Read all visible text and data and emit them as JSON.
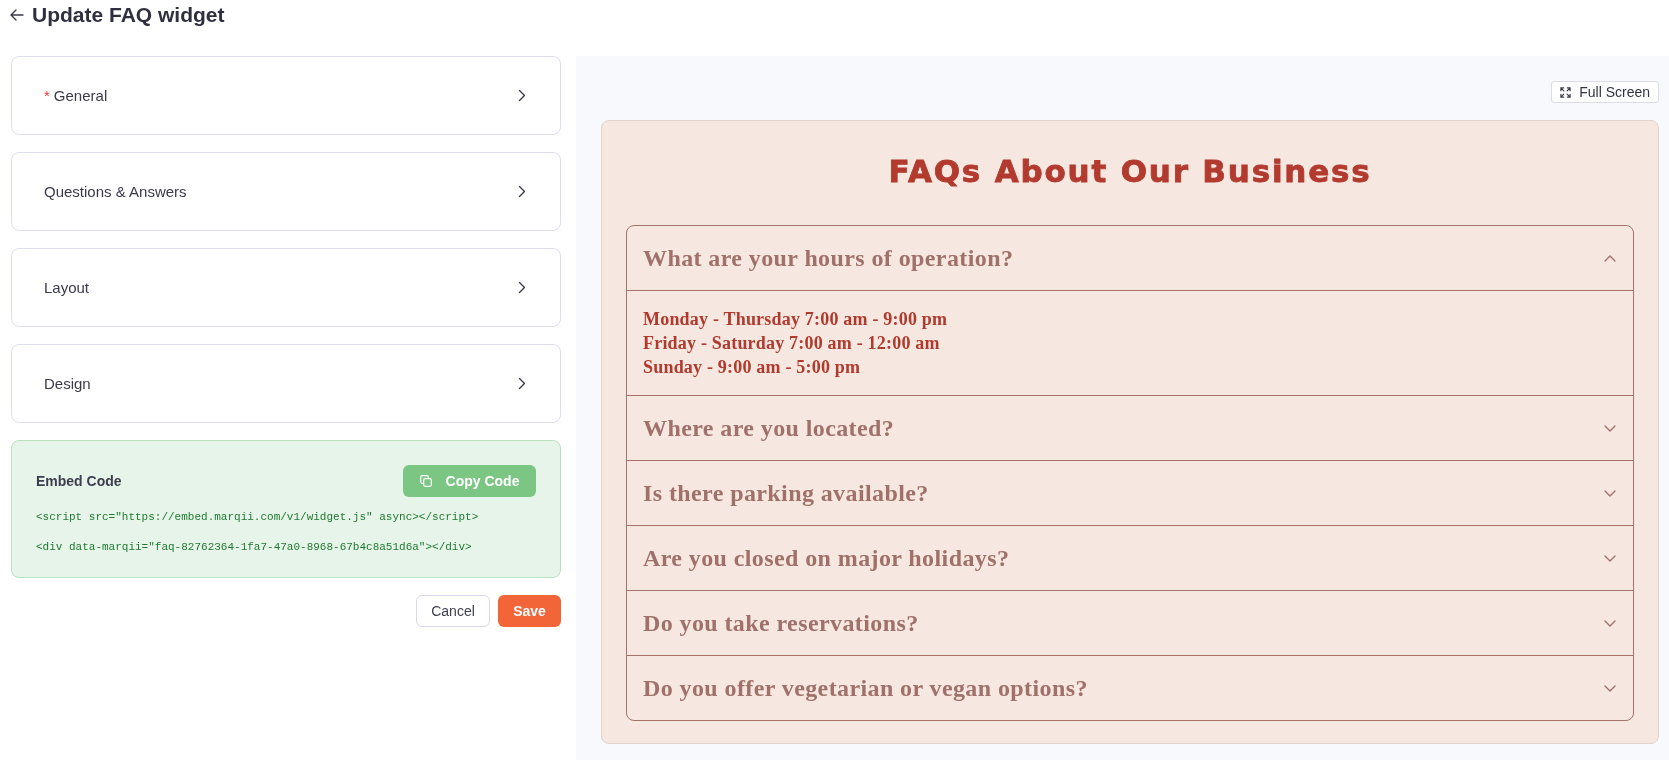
{
  "header": {
    "title": "Update FAQ widget"
  },
  "sections": [
    {
      "label": "General",
      "required_mark": "*"
    },
    {
      "label": "Questions & Answers"
    },
    {
      "label": "Layout"
    },
    {
      "label": "Design"
    }
  ],
  "embed_code": {
    "title": "Embed Code",
    "copy_button": "Copy Code",
    "lines": [
      "<script src=\"https://embed.marqii.com/v1/widget.js\" async></script>",
      "<div data-marqii=\"faq-82762364-1fa7-47a0-8968-67b4c8a51d6a\"></div>"
    ]
  },
  "actions": {
    "cancel": "Cancel",
    "save": "Save"
  },
  "preview": {
    "full_screen_button": "Full Screen",
    "faq": {
      "title": "FAQs About Our Business",
      "items": [
        {
          "question": "What are your hours of operation?",
          "expanded": true,
          "answer_lines": [
            "Monday - Thursday 7:00 am - 9:00 pm",
            "Friday - Saturday 7:00 am - 12:00 am",
            "Sunday - 9:00 am - 5:00 pm"
          ]
        },
        {
          "question": "Where are you located?",
          "expanded": false
        },
        {
          "question": "Is there parking available?",
          "expanded": false
        },
        {
          "question": "Are you closed on major holidays?",
          "expanded": false
        },
        {
          "question": "Do you take reservations?",
          "expanded": false
        },
        {
          "question": "Do you offer vegetarian or vegan options?",
          "expanded": false
        }
      ]
    }
  }
}
